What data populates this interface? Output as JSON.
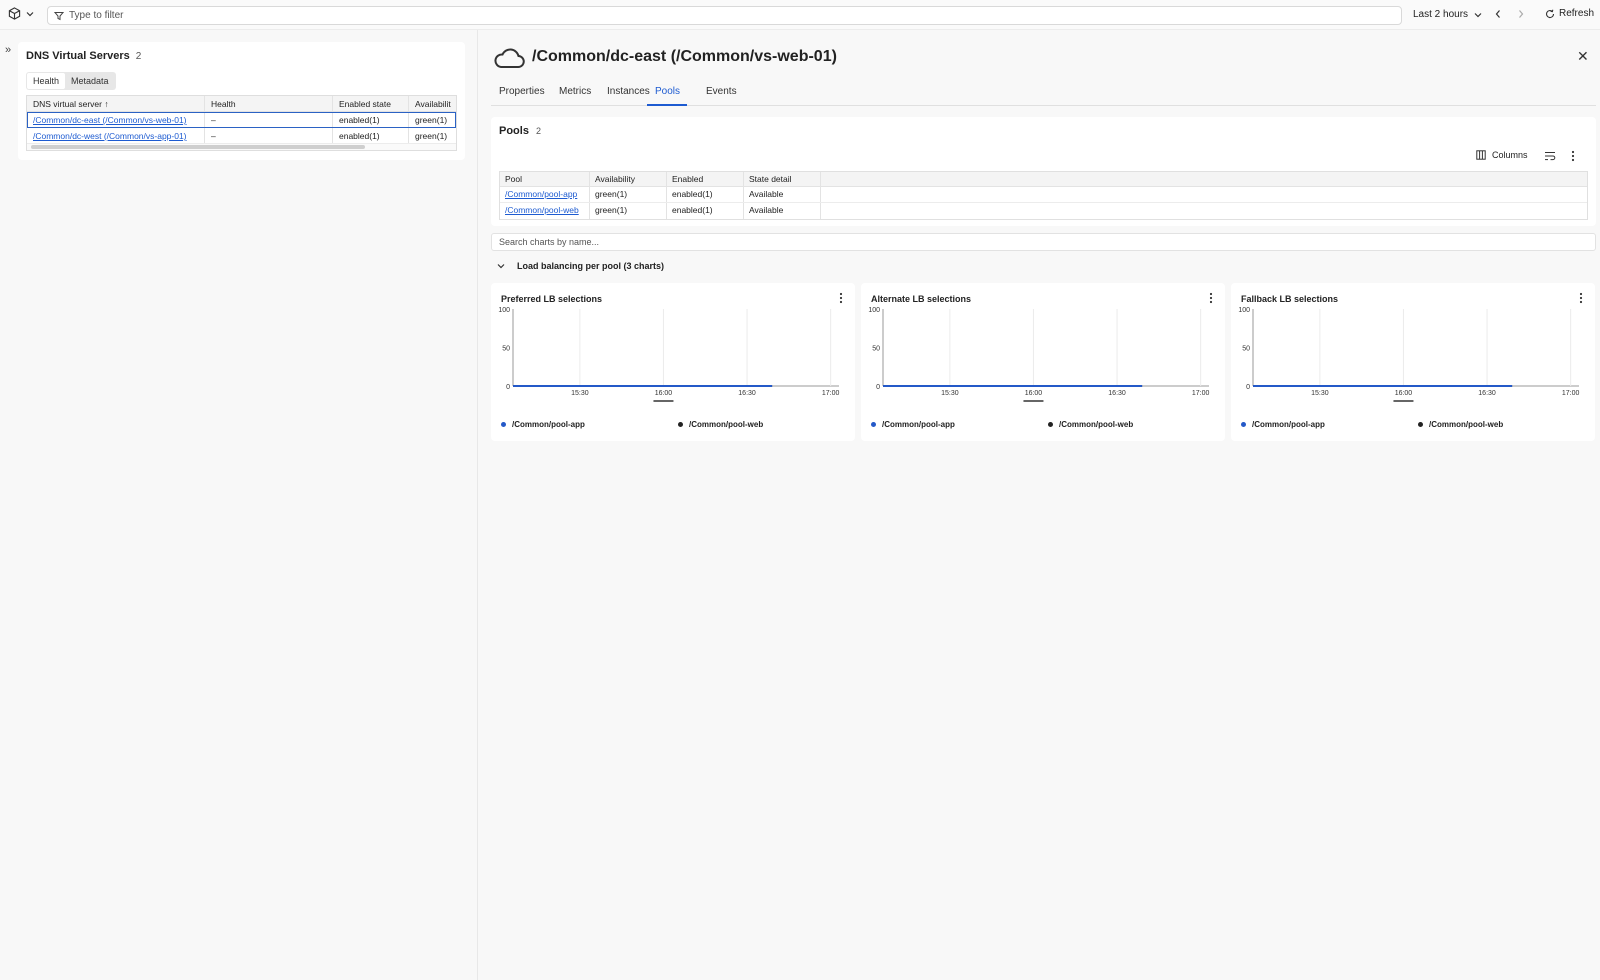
{
  "topbar": {
    "filter_placeholder": "Type to filter",
    "time_range": "Last 2 hours",
    "refresh_label": "Refresh"
  },
  "left": {
    "title": "DNS Virtual Servers",
    "count": "2",
    "tabs": [
      "Health",
      "Metadata"
    ],
    "columns": [
      "DNS virtual server",
      "Health",
      "Enabled state",
      "Availabilit"
    ],
    "rows": [
      {
        "name": "/Common/dc-east (/Common/vs-web-01)",
        "health": "–",
        "enabled": "enabled(1)",
        "availability": "green(1)",
        "selected": true
      },
      {
        "name": "/Common/dc-west (/Common/vs-app-01)",
        "health": "–",
        "enabled": "enabled(1)",
        "availability": "green(1)",
        "selected": false
      }
    ]
  },
  "detail": {
    "title": "/Common/dc-east (/Common/vs-web-01)",
    "tabs": [
      "Properties",
      "Metrics",
      "Instances",
      "Pools",
      "Events"
    ],
    "active_tab": "Pools"
  },
  "pools": {
    "title": "Pools",
    "count": "2",
    "columns_label": "Columns",
    "headers": [
      "Pool",
      "Availability",
      "Enabled",
      "State detail"
    ],
    "rows": [
      {
        "pool": "/Common/pool-app",
        "availability": "green(1)",
        "enabled": "enabled(1)",
        "state": "Available"
      },
      {
        "pool": "/Common/pool-web",
        "availability": "green(1)",
        "enabled": "enabled(1)",
        "state": "Available"
      }
    ]
  },
  "search": {
    "placeholder": "Search charts by name..."
  },
  "section": {
    "title": "Load balancing per pool (3 charts)"
  },
  "colors": {
    "accent": "#1d5bd1",
    "series_app": "#2459c8",
    "series_web": "#222222"
  },
  "chart_data": [
    {
      "type": "line",
      "title": "Preferred LB selections",
      "x_ticks": [
        "15:30",
        "16:00",
        "16:30",
        "17:00"
      ],
      "y_ticks": [
        0,
        50,
        100
      ],
      "ylim": [
        0,
        100
      ],
      "series": [
        {
          "name": "/Common/pool-app",
          "values": [
            0,
            0,
            0,
            0,
            0
          ]
        },
        {
          "name": "/Common/pool-web",
          "values": [
            0,
            0,
            0,
            0,
            0
          ]
        }
      ]
    },
    {
      "type": "line",
      "title": "Alternate LB selections",
      "x_ticks": [
        "15:30",
        "16:00",
        "16:30",
        "17:00"
      ],
      "y_ticks": [
        0,
        50,
        100
      ],
      "ylim": [
        0,
        100
      ],
      "series": [
        {
          "name": "/Common/pool-app",
          "values": [
            0,
            0,
            0,
            0,
            0
          ]
        },
        {
          "name": "/Common/pool-web",
          "values": [
            0,
            0,
            0,
            0,
            0
          ]
        }
      ]
    },
    {
      "type": "line",
      "title": "Fallback LB selections",
      "x_ticks": [
        "15:30",
        "16:00",
        "16:30",
        "17:00"
      ],
      "y_ticks": [
        0,
        50,
        100
      ],
      "ylim": [
        0,
        100
      ],
      "series": [
        {
          "name": "/Common/pool-app",
          "values": [
            0,
            0,
            0,
            0,
            0
          ]
        },
        {
          "name": "/Common/pool-web",
          "values": [
            0,
            0,
            0,
            0,
            0
          ]
        }
      ]
    }
  ]
}
